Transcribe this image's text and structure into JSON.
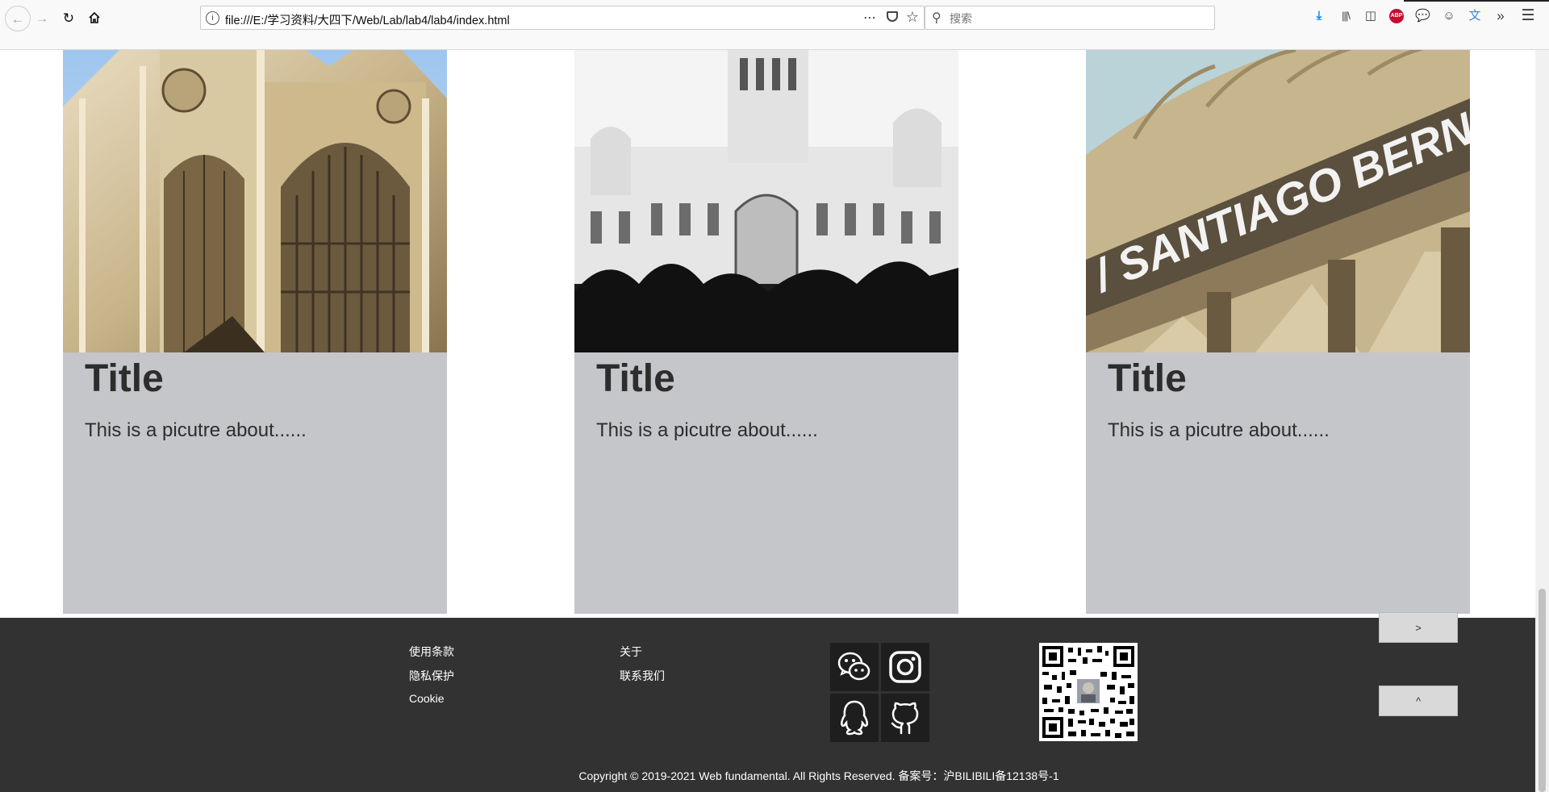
{
  "browser": {
    "url": "file:///E:/学习资料/大四下/Web/Lab/lab4/lab4/index.html",
    "search_placeholder": "搜索",
    "abp_label": "ABP",
    "icons": [
      "back-icon",
      "forward-icon",
      "reload-icon",
      "home-icon",
      "info-icon",
      "more-icon",
      "pocket-icon",
      "star-icon",
      "search-icon",
      "download-icon",
      "library-icon",
      "sidebar-icon",
      "abp-icon",
      "chat-icon",
      "account-icon",
      "translate-icon",
      "overflow-icon",
      "menu-icon"
    ]
  },
  "cards": [
    {
      "title": "Title",
      "text": "This is a picutre about......",
      "image": "gothic-cathedral-facade"
    },
    {
      "title": "Title",
      "text": "This is a picutre about......",
      "image": "cibeles-palace"
    },
    {
      "title": "Title",
      "text": "This is a picutre about......",
      "image": "santiago-bernabeu-stadium"
    }
  ],
  "footer": {
    "links_col1": [
      "使用条款",
      "隐私保护",
      "Cookie"
    ],
    "links_col2": [
      "关于",
      "联系我们"
    ],
    "social": [
      "wechat-icon",
      "instagram-icon",
      "qq-icon",
      "github-icon"
    ],
    "copyright": "Copyright © 2019-2021 Web fundamental. All Rights Reserved. 备案号：沪BILIBILI备12138号-1"
  },
  "float_buttons": {
    "next": ">",
    "top": "^"
  },
  "colors": {
    "card_bg": "#c5c6c9",
    "footer_bg": "#323232",
    "social_bg": "#1e1e1e",
    "title_text": "#2d2d2d",
    "accent_blue": "#0a84ff",
    "abp_red": "#c70d2c"
  }
}
